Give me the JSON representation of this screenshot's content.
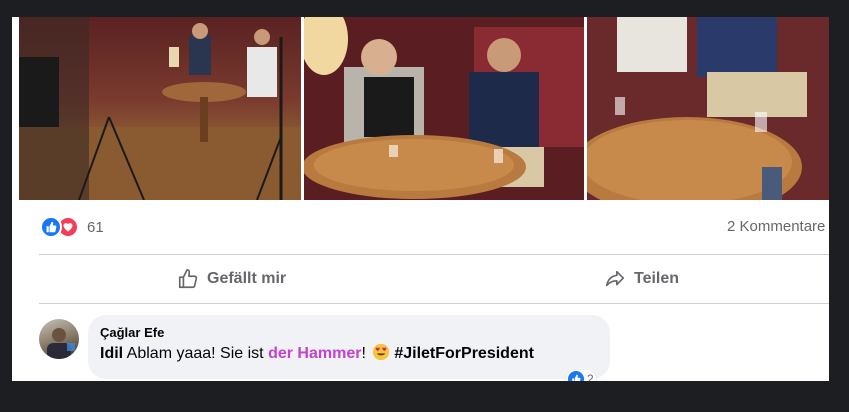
{
  "post": {
    "photos": [
      {
        "name": "photo-behind-the-scenes"
      },
      {
        "name": "photo-interview-table"
      },
      {
        "name": "photo-couch-closeup"
      }
    ],
    "reactions": {
      "icons": [
        "like-icon",
        "love-icon"
      ],
      "count": "61"
    },
    "comments_count": "2 Kommentare",
    "actions": {
      "like_label": "Gefällt mir",
      "share_label": "Teilen"
    }
  },
  "comment": {
    "author": "Çağlar Efe",
    "mention": "Idil",
    "text_1": " Ablam yaaa! Sie ist ",
    "highlight": "der Hammer",
    "text_2": "! ",
    "emoji": "heart-eyes-emoji",
    "hashtag": "#JiletForPresident",
    "reaction_count": "2"
  },
  "colors": {
    "accent": "#1877f2",
    "love": "#f33e58",
    "highlight": "#c442d0",
    "bubble_bg": "#f0f2f5",
    "muted_text": "#65676b"
  }
}
